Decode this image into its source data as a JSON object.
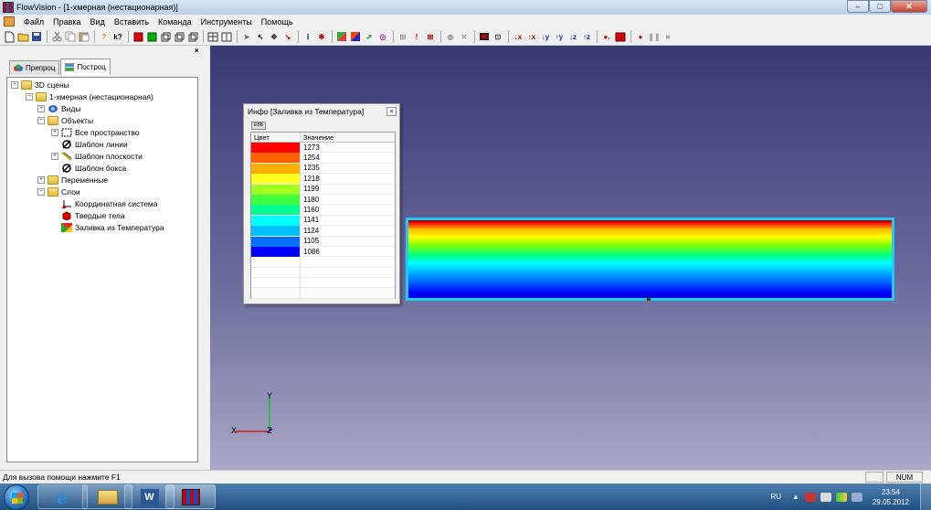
{
  "window": {
    "title": "FlowVision - [1-хмерная (нестационарная)]",
    "min_label": "–",
    "max_label": "□",
    "close_label": "✕"
  },
  "menu": [
    "Файл",
    "Правка",
    "Вид",
    "Вставить",
    "Команда",
    "Инструменты",
    "Помощь"
  ],
  "mdi_buttons": [
    "–",
    "▫",
    "✕"
  ],
  "left_panel": {
    "close_label": "×",
    "tabs": [
      {
        "label": "Препроц",
        "active": false
      },
      {
        "label": "Построц",
        "active": true
      }
    ]
  },
  "tree": [
    {
      "label": "3D сцены",
      "expander": "−",
      "icon": "folder-icon"
    },
    {
      "label": "1-хмерная (нестационарная)",
      "expander": "−",
      "icon": "folder-icon"
    },
    {
      "label": "Виды",
      "expander": "+",
      "icon": "views-icon"
    },
    {
      "label": "Объекты",
      "expander": "−",
      "icon": "folder-icon"
    },
    {
      "label": "Все пространство",
      "expander": "+",
      "icon": "space-icon"
    },
    {
      "label": "Шаблон линии",
      "expander": "",
      "icon": "line-template-icon"
    },
    {
      "label": "Шаблон плоскости",
      "expander": "+",
      "icon": "plane-template-icon"
    },
    {
      "label": "Шаблон бокса",
      "expander": "",
      "icon": "box-template-icon"
    },
    {
      "label": "Переменные",
      "expander": "+",
      "icon": "folder-icon"
    },
    {
      "label": "Слои",
      "expander": "−",
      "icon": "folder-icon"
    },
    {
      "label": "Координатная система",
      "expander": "",
      "icon": "axes-icon"
    },
    {
      "label": "Твердые тела",
      "expander": "",
      "icon": "solid-icon"
    },
    {
      "label": "Заливка из Температура",
      "expander": "",
      "icon": "fill-icon"
    }
  ],
  "info_window": {
    "title": "Инфо [Заливка из Температура]",
    "close_label": "×",
    "tool_label": "ЕВВ",
    "col_color": "Цвет",
    "col_value": "Значение",
    "rows": [
      {
        "color": "#ff0000",
        "value": "1273"
      },
      {
        "color": "#ff6000",
        "value": "1254"
      },
      {
        "color": "#ffb000",
        "value": "1235"
      },
      {
        "color": "#ffff20",
        "value": "1218"
      },
      {
        "color": "#a0ff20",
        "value": "1199"
      },
      {
        "color": "#40ff40",
        "value": "1180"
      },
      {
        "color": "#00ff90",
        "value": "1160"
      },
      {
        "color": "#00ffff",
        "value": "1141"
      },
      {
        "color": "#00c0ff",
        "value": "1124"
      },
      {
        "color": "#0070ff",
        "value": "1105"
      },
      {
        "color": "#0000ff",
        "value": "1086"
      }
    ]
  },
  "axes": {
    "y": "Y",
    "x": "X",
    "z": "Z"
  },
  "status": {
    "text": "Для вызова помощи нажмите F1",
    "num": "NUM"
  },
  "taskbar": {
    "lang": "RU",
    "time": "23:54",
    "date": "29.05.2012",
    "ie_label": "e",
    "word_label": "W"
  },
  "colors": {
    "bar_outline": "#1ecdf3",
    "viewport_top": "#3a3973",
    "viewport_bottom": "#a8a8c7"
  }
}
